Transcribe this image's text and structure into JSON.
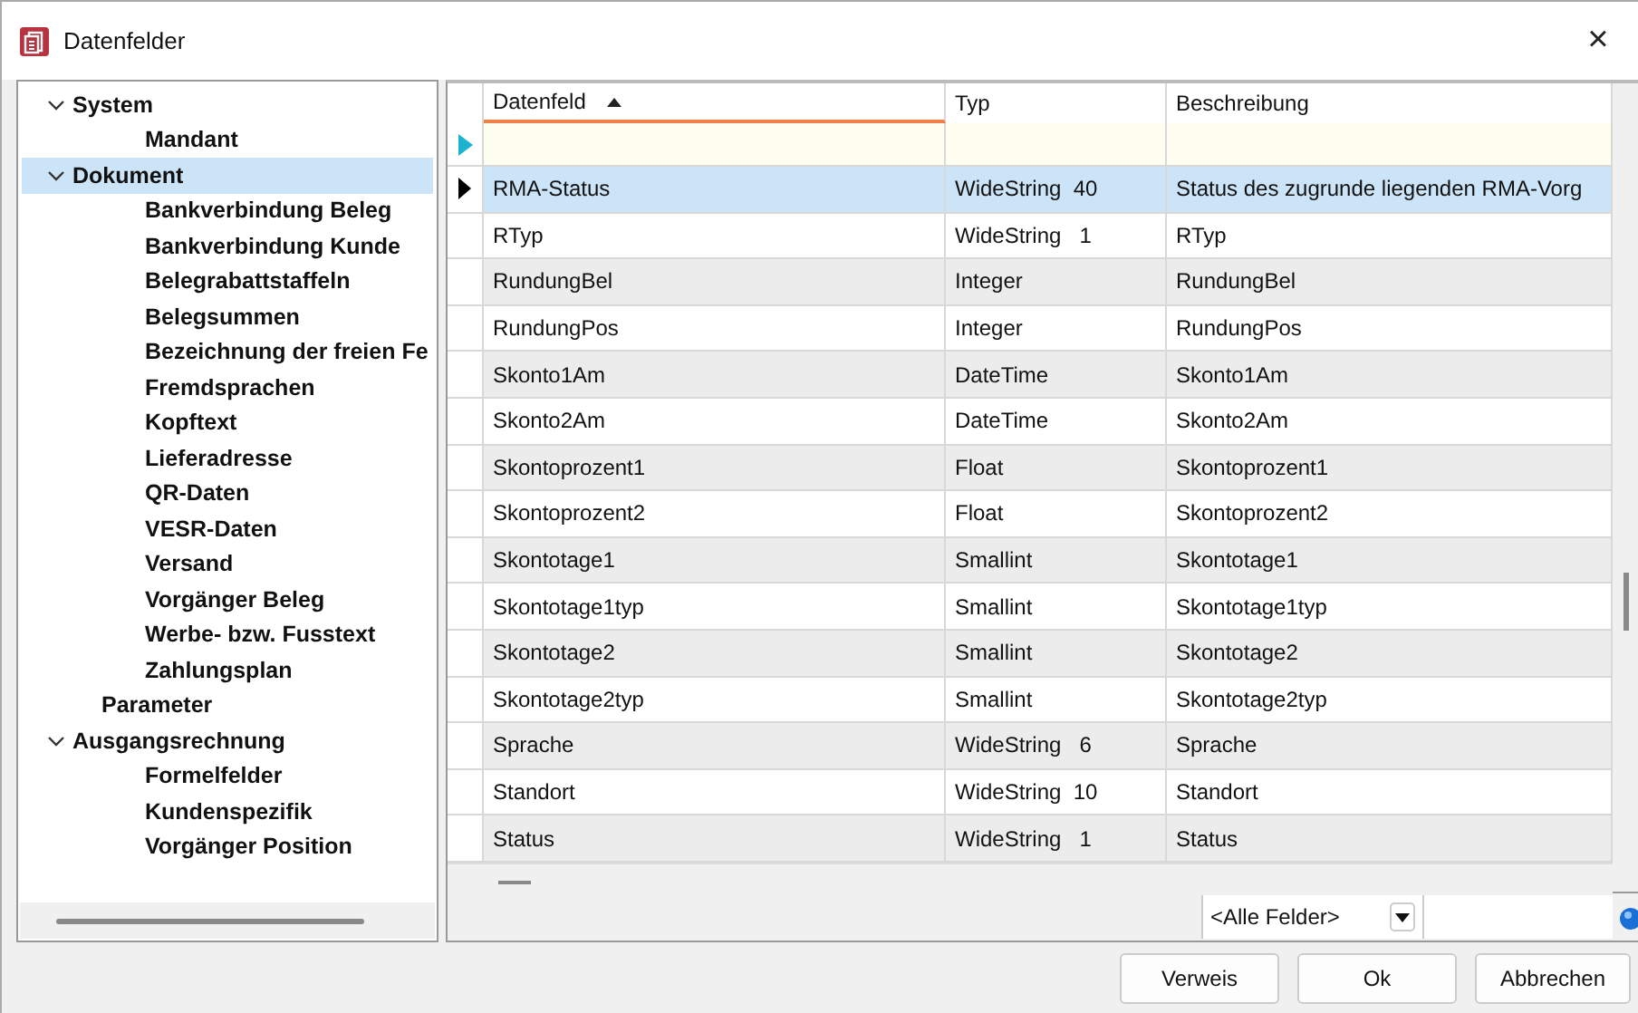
{
  "window": {
    "title": "Datenfelder",
    "close": "×"
  },
  "tree": [
    {
      "label": "System",
      "expanded": true,
      "selected": false,
      "children": [
        {
          "label": "Mandant",
          "selected": false
        }
      ]
    },
    {
      "label": "Dokument",
      "expanded": true,
      "selected": true,
      "children": [
        {
          "label": "Bankverbindung Beleg",
          "selected": false
        },
        {
          "label": "Bankverbindung Kunde",
          "selected": false
        },
        {
          "label": "Belegrabattstaffeln",
          "selected": false
        },
        {
          "label": "Belegsummen",
          "selected": false
        },
        {
          "label": "Bezeichnung der freien Fe",
          "selected": false
        },
        {
          "label": "Fremdsprachen",
          "selected": false
        },
        {
          "label": "Kopftext",
          "selected": false
        },
        {
          "label": "Lieferadresse",
          "selected": false
        },
        {
          "label": "QR-Daten",
          "selected": false
        },
        {
          "label": "VESR-Daten",
          "selected": false
        },
        {
          "label": "Versand",
          "selected": false
        },
        {
          "label": "Vorgänger Beleg",
          "selected": false
        },
        {
          "label": "Werbe- bzw. Fusstext",
          "selected": false
        },
        {
          "label": "Zahlungsplan",
          "selected": false
        }
      ]
    },
    {
      "label": "Parameter",
      "selected": false
    },
    {
      "label": "Ausgangsrechnung",
      "expanded": true,
      "selected": false,
      "children": [
        {
          "label": "Formelfelder",
          "selected": false
        },
        {
          "label": "Kundenspezifik",
          "selected": false
        },
        {
          "label": "Vorgänger Position",
          "selected": false
        }
      ]
    }
  ],
  "table": {
    "columns": [
      {
        "label": "Datenfeld",
        "sorted": true
      },
      {
        "label": "Typ",
        "sorted": false
      },
      {
        "label": "Beschreibung",
        "sorted": false
      }
    ],
    "rows": [
      {
        "cells": [
          "RMA-Status",
          "WideString  40",
          "Status des zugrunde liegenden RMA-Vorg"
        ],
        "selected": true
      },
      {
        "cells": [
          "RTyp",
          "WideString   1",
          "RTyp"
        ],
        "selected": false
      },
      {
        "cells": [
          "RundungBel",
          "Integer",
          "RundungBel"
        ],
        "selected": false
      },
      {
        "cells": [
          "RundungPos",
          "Integer",
          "RundungPos"
        ],
        "selected": false
      },
      {
        "cells": [
          "Skonto1Am",
          "DateTime",
          "Skonto1Am"
        ],
        "selected": false
      },
      {
        "cells": [
          "Skonto2Am",
          "DateTime",
          "Skonto2Am"
        ],
        "selected": false
      },
      {
        "cells": [
          "Skontoprozent1",
          "Float",
          "Skontoprozent1"
        ],
        "selected": false
      },
      {
        "cells": [
          "Skontoprozent2",
          "Float",
          "Skontoprozent2"
        ],
        "selected": false
      },
      {
        "cells": [
          "Skontotage1",
          "Smallint",
          "Skontotage1"
        ],
        "selected": false
      },
      {
        "cells": [
          "Skontotage1typ",
          "Smallint",
          "Skontotage1typ"
        ],
        "selected": false
      },
      {
        "cells": [
          "Skontotage2",
          "Smallint",
          "Skontotage2"
        ],
        "selected": false
      },
      {
        "cells": [
          "Skontotage2typ",
          "Smallint",
          "Skontotage2typ"
        ],
        "selected": false
      },
      {
        "cells": [
          "Sprache",
          "WideString   6",
          "Sprache"
        ],
        "selected": false
      },
      {
        "cells": [
          "Standort",
          "WideString  10",
          "Standort"
        ],
        "selected": false
      },
      {
        "cells": [
          "Status",
          "WideString   1",
          "Status"
        ],
        "selected": false
      }
    ]
  },
  "filter": {
    "field_combo": "<Alle Felder>"
  },
  "buttons": [
    "Verweis",
    "Ok",
    "Abbrechen"
  ]
}
